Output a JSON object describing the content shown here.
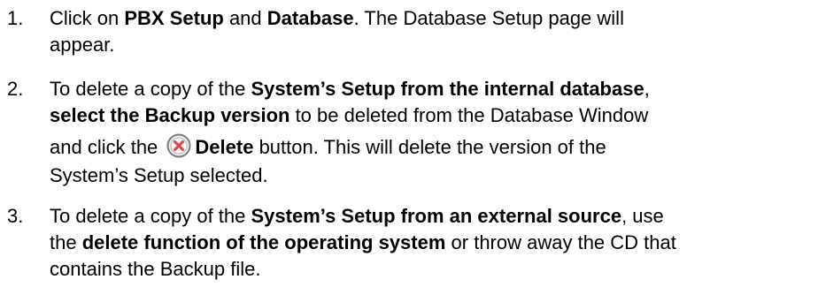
{
  "steps": [
    {
      "number": "1.",
      "line1_pre": "Click on ",
      "line1_b1": "PBX Setup",
      "line1_mid": " and ",
      "line1_b2": "Database",
      "line1_post": ". The Database Setup page will",
      "line2": "appear."
    },
    {
      "number": "2.",
      "line1_pre": "To delete a copy of the ",
      "line1_b1": "System’s Setup from the internal database",
      "line1_post": ",",
      "line2_b1": "select the Backup version",
      "line2_post": " to be deleted from the Database Window",
      "line3_pre": "and click the ",
      "line3_icon": "delete-x-icon",
      "line3_b1": "Delete",
      "line3_post": " button. This will delete the version of the",
      "line4": "System’s Setup selected."
    },
    {
      "number": "3.",
      "line1_pre": "To delete a copy of the ",
      "line1_b1": "System’s Setup from an external source",
      "line1_post": ", use",
      "line2_pre": "the ",
      "line2_b1": "delete function of the operating system",
      "line2_post": " or throw away the CD that",
      "line3": "contains the Backup file."
    }
  ],
  "colors": {
    "text": "#000000",
    "icon_ring": "#7a7a7a",
    "icon_fill": "#e24a4a"
  }
}
